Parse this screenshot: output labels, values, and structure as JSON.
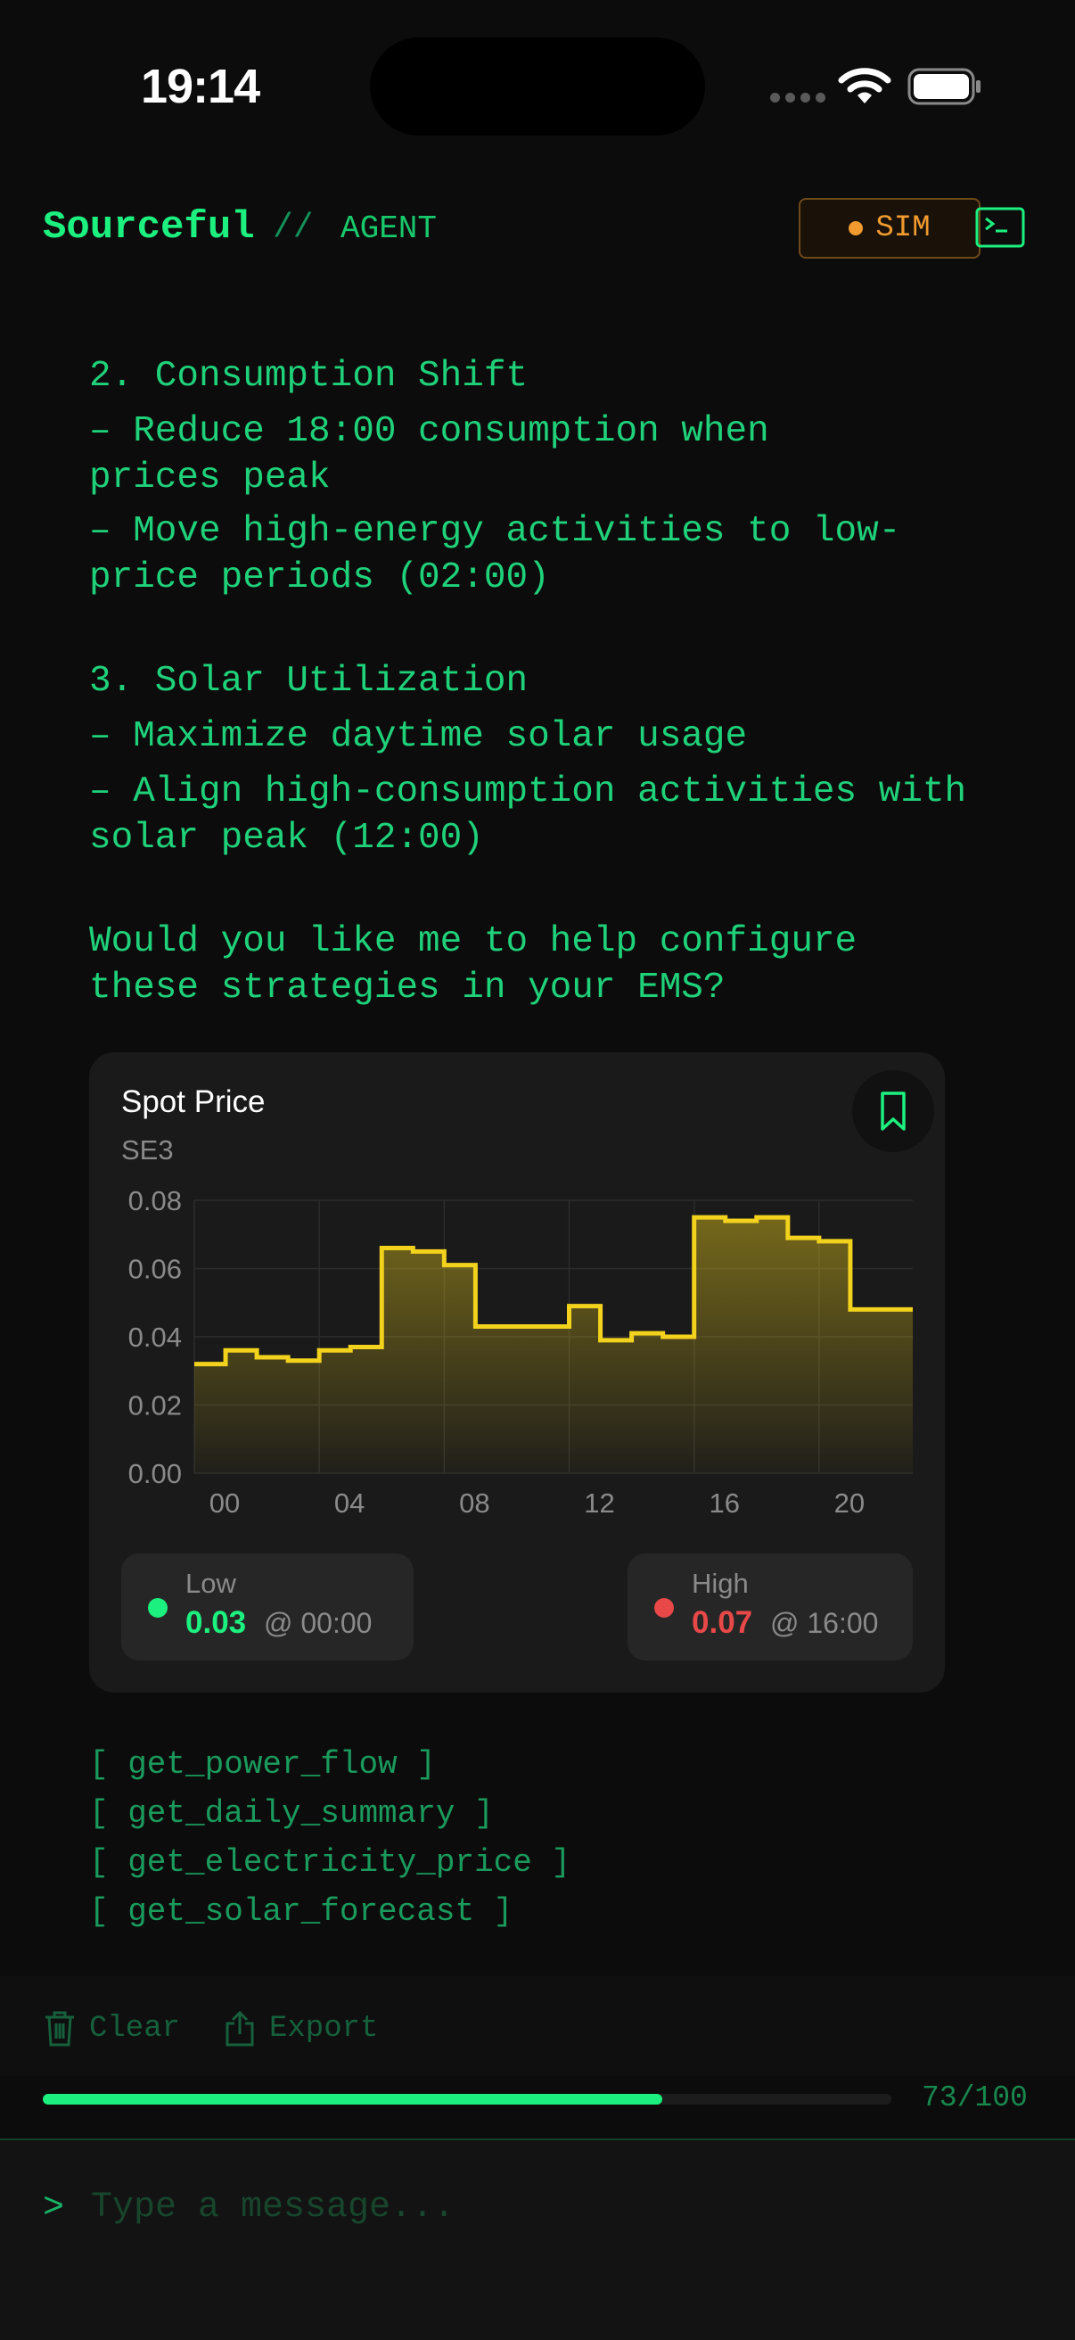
{
  "status": {
    "time": "19:14"
  },
  "header": {
    "brand": "Sourceful",
    "separator": "//",
    "subtitle": "AGENT",
    "mode_badge": "SIM",
    "mode_color": "#f09a30"
  },
  "message": {
    "lines": [
      "2. Consumption Shift",
      "– Reduce 18:00 consumption when",
      "prices peak",
      "– Move high-energy activities to low-",
      "price periods (02:00)",
      "3. Solar Utilization",
      "– Maximize daytime solar usage",
      "– Align high-consumption activities with",
      "solar peak (12:00)",
      "Would you like me to help configure",
      "these strategies in your EMS?"
    ]
  },
  "chart_card": {
    "title": "Spot Price",
    "subtitle": "SE3",
    "low": {
      "label": "Low",
      "value": "0.03",
      "time": "@ 00:00",
      "color": "#1cf07e"
    },
    "high": {
      "label": "High",
      "value": "0.07",
      "time": "@ 16:00",
      "color": "#e84848"
    }
  },
  "chart_data": {
    "type": "area",
    "title": "Spot Price",
    "subtitle": "SE3",
    "step": true,
    "color": "#f2d21c",
    "x": [
      0,
      1,
      2,
      3,
      4,
      5,
      6,
      7,
      8,
      9,
      10,
      11,
      12,
      13,
      14,
      15,
      16,
      17,
      18,
      19,
      20,
      21,
      22,
      23
    ],
    "x_tick_labels": [
      "00",
      "04",
      "08",
      "12",
      "16",
      "20"
    ],
    "x_tick_positions": [
      0,
      4,
      8,
      12,
      16,
      20
    ],
    "values": [
      0.032,
      0.036,
      0.034,
      0.033,
      0.036,
      0.037,
      0.066,
      0.065,
      0.061,
      0.043,
      0.043,
      0.043,
      0.049,
      0.039,
      0.041,
      0.04,
      0.075,
      0.074,
      0.075,
      0.069,
      0.068,
      0.048,
      0.048,
      0.048
    ],
    "y_ticks": [
      "0.08",
      "0.06",
      "0.04",
      "0.02",
      "0.00"
    ],
    "ylim": [
      0,
      0.08
    ],
    "xlim": [
      0,
      23
    ],
    "grid": true
  },
  "tools": [
    "[ get_power_flow ]",
    "[ get_daily_summary ]",
    "[ get_electricity_price ]",
    "[ get_solar_forecast ]"
  ],
  "actions": {
    "clear": "Clear",
    "export": "Export"
  },
  "usage": {
    "text": "73/100",
    "fraction": 0.73
  },
  "input": {
    "prompt": ">",
    "placeholder": "Type a message..."
  }
}
